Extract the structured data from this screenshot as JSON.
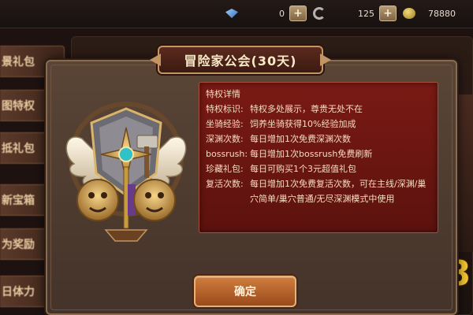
{
  "resources": {
    "gems": {
      "value": "0",
      "icon": "gem-icon"
    },
    "tokens": {
      "value": "125",
      "icon": "swirl-icon"
    },
    "coins": {
      "value": "78880",
      "icon": "coin-icon"
    }
  },
  "side_menu": {
    "items": [
      {
        "label": "景礼包"
      },
      {
        "label": "图特权"
      },
      {
        "label": "抵礼包"
      },
      {
        "label": "新宝箱"
      },
      {
        "label": "为奖励"
      },
      {
        "label": "日体力"
      }
    ]
  },
  "background_number": "8",
  "dialog": {
    "title": "冒险家公会(30天)",
    "detail_heading": "特权详情",
    "privileges": [
      {
        "key": "特权标识:",
        "value": "特权多处展示，尊贵无处不在"
      },
      {
        "key": "坐骑经验:",
        "value": "饲养坐骑获得10%经验加成"
      },
      {
        "key": "深渊次数:",
        "value": "每日增加1次免费深渊次数"
      },
      {
        "key": "bossrush:",
        "value": "每日增加1次bossrush免费刷新"
      },
      {
        "key": "珍藏礼包:",
        "value": "每日可购买1个3元超值礼包"
      },
      {
        "key": "复活次数:",
        "value": "每日增加1次免费复活次数，可在主线/深渊/巢穴简单/巢穴普通/无尽深渊模式中使用"
      }
    ],
    "confirm_label": "确定"
  },
  "colors": {
    "detail_bg": "#6e1711",
    "button": "#c06a30",
    "accent_gold": "#c29562"
  }
}
